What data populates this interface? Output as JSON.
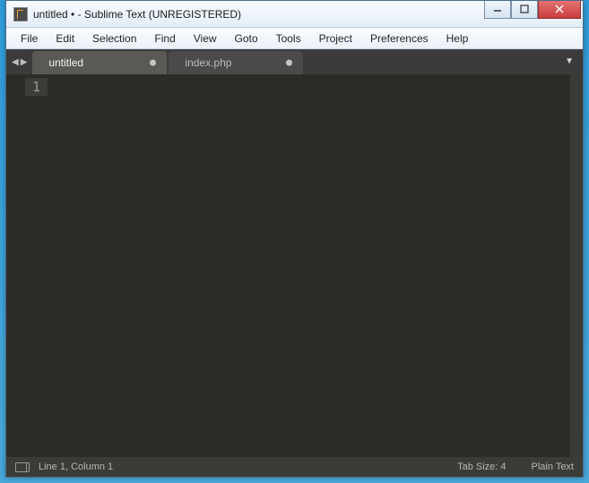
{
  "window": {
    "title": "untitled • - Sublime Text (UNREGISTERED)"
  },
  "menu": {
    "items": [
      "File",
      "Edit",
      "Selection",
      "Find",
      "View",
      "Goto",
      "Tools",
      "Project",
      "Preferences",
      "Help"
    ]
  },
  "tabs": {
    "items": [
      {
        "label": "untitled",
        "active": true,
        "dirty": true
      },
      {
        "label": "index.php",
        "active": false,
        "dirty": true
      }
    ]
  },
  "editor": {
    "line_numbers": [
      "1"
    ]
  },
  "status": {
    "position": "Line 1, Column 1",
    "tab_size": "Tab Size: 4",
    "syntax": "Plain Text"
  }
}
